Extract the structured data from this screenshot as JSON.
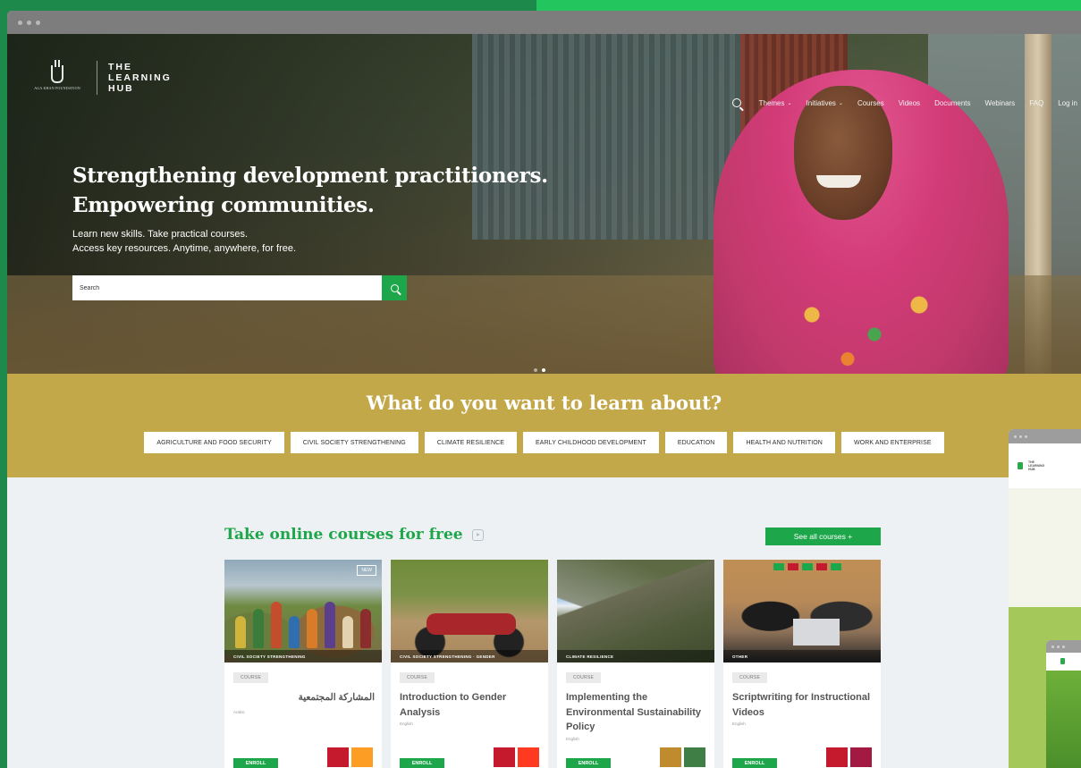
{
  "browser": {
    "window_controls": [
      "dot",
      "dot",
      "dot"
    ]
  },
  "brand": {
    "foundation": "AGA KHAN FOUNDATION",
    "title_line1": "THE",
    "title_line2": "LEARNING",
    "title_line3": "HUB"
  },
  "nav": {
    "items": [
      {
        "label": "Themes",
        "has_dropdown": true
      },
      {
        "label": "Initiatives",
        "has_dropdown": true
      },
      {
        "label": "Courses",
        "has_dropdown": false
      },
      {
        "label": "Videos",
        "has_dropdown": false
      },
      {
        "label": "Documents",
        "has_dropdown": false
      },
      {
        "label": "Webinars",
        "has_dropdown": false
      },
      {
        "label": "FAQ",
        "has_dropdown": false
      },
      {
        "label": "Log in",
        "has_dropdown": false
      }
    ],
    "chevron": "⌄"
  },
  "hero": {
    "title_line1": "Strengthening development practitioners.",
    "title_line2": "Empowering communities.",
    "sub_line1": "Learn new skills. Take practical courses.",
    "sub_line2": "Access key resources. Anytime, anywhere, for free.",
    "search_placeholder": "Search",
    "active_slide": 2,
    "slides": 2
  },
  "topics": {
    "title": "What do you want to learn about?",
    "items": [
      "AGRICULTURE AND FOOD SECURITY",
      "CIVIL SOCIETY STRENGTHENING",
      "CLIMATE RESILIENCE",
      "EARLY CHILDHOOD DEVELOPMENT",
      "EDUCATION",
      "HEALTH AND NUTRITION",
      "WORK AND ENTERPRISE"
    ]
  },
  "courses": {
    "title": "Take online courses for free",
    "see_all": "See all courses  +",
    "cards": [
      {
        "tag": "CIVIL SOCIETY STRENGTHENING",
        "badge": "NEW",
        "kind": "COURSE",
        "title": "المشاركة المجتمعية",
        "lang": "Arabic",
        "enroll": "ENROLL",
        "rtl": true
      },
      {
        "tag": "CIVIL SOCIETY STRENGTHENING · GENDER",
        "badge": "",
        "kind": "COURSE",
        "title": "Introduction to Gender Analysis",
        "lang": "English",
        "enroll": "ENROLL",
        "rtl": false
      },
      {
        "tag": "CLIMATE RESILIENCE",
        "badge": "",
        "kind": "COURSE",
        "title": "Implementing the Environmental Sustainability Policy",
        "lang": "English",
        "enroll": "ENROLL",
        "rtl": false
      },
      {
        "tag": "OTHER",
        "badge": "",
        "kind": "COURSE",
        "title": "Scriptwriting for Instructional Videos",
        "lang": "English",
        "enroll": "ENROLL",
        "rtl": false
      }
    ],
    "sdg_colors": [
      [
        "#c5192d",
        "#fd9d24"
      ],
      [
        "#c5192d",
        "#ff3a21"
      ],
      [
        "#bf8b2e",
        "#3f7e44"
      ],
      [
        "#c5192d",
        "#a21942"
      ]
    ]
  },
  "side_preview": {
    "title_line1": "THE",
    "title_line2": "LEARNING",
    "title_line3": "HUB"
  },
  "colors": {
    "accent_green": "#1ea64a",
    "topics_gold": "#c3a84a",
    "page_green": "#1d8a4c"
  }
}
